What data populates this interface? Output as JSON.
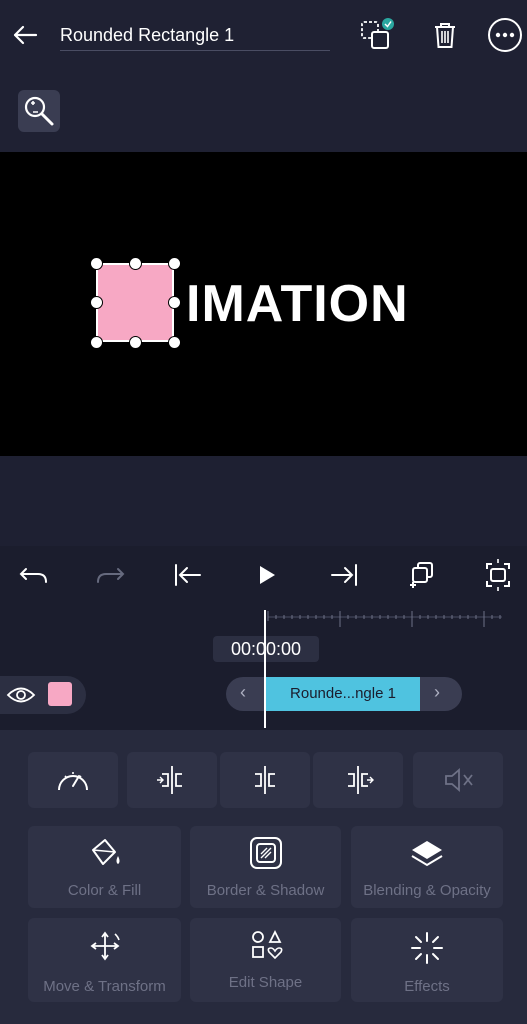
{
  "header": {
    "title": "Rounded Rectangle 1"
  },
  "canvas": {
    "text": "IMATION",
    "shape_color": "#f7a8c4"
  },
  "timeline": {
    "timecode": "00:00:00",
    "clip_label": "Rounde...ngle 1",
    "prev_glyph": "‹",
    "next_glyph": "›"
  },
  "tools": {
    "color_fill": "Color & Fill",
    "border_shadow": "Border & Shadow",
    "blending_opacity": "Blending & Opacity",
    "move_transform": "Move & Transform",
    "edit_shape": "Edit Shape",
    "effects": "Effects"
  },
  "colors": {
    "accent": "#4fc3e0",
    "background": "#1e2032",
    "panel": "#272a3d"
  }
}
